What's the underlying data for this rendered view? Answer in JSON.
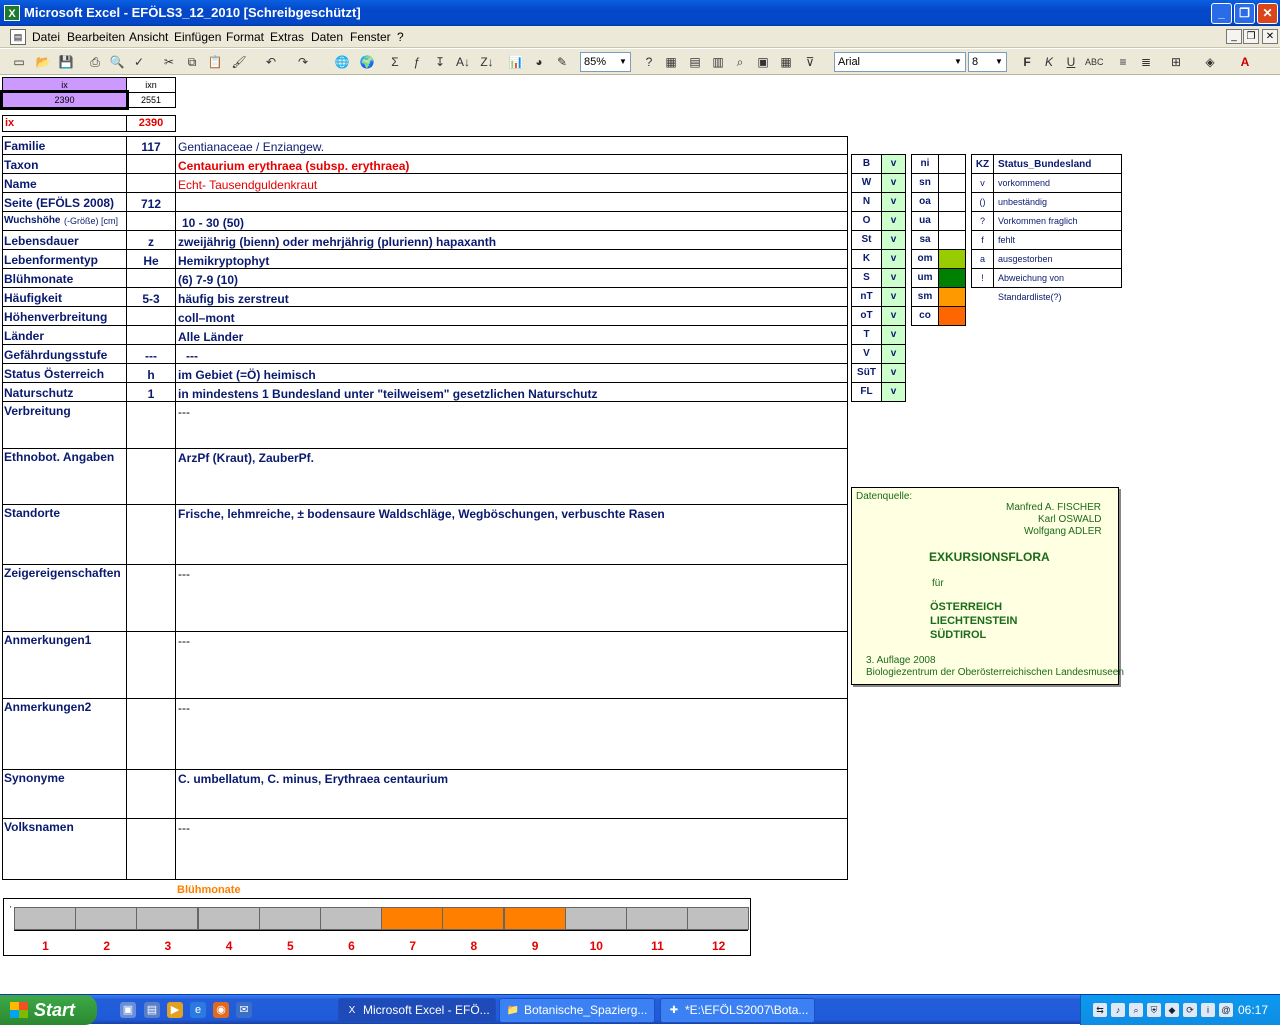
{
  "window": {
    "title": "Microsoft Excel - EFÖLS3_12_2010  [Schreibgeschützt]",
    "btn_min": "_",
    "btn_max": "❐",
    "btn_close": "✕"
  },
  "menu": {
    "items": [
      "Datei",
      "Bearbeiten",
      "Ansicht",
      "Einfügen",
      "Format",
      "Extras",
      "Daten",
      "Fenster",
      "?"
    ]
  },
  "toolbar": {
    "zoom": "85%",
    "font": "Arial",
    "size": "8"
  },
  "header": {
    "ix_label": "ix",
    "ixn_label": "ixn",
    "ix_value": "2390",
    "ixn_value": "2551",
    "ix2_label": "ix",
    "ix2_value": "2390"
  },
  "fields": [
    {
      "label": "Familie",
      "code": "117",
      "value": "Gentianaceae / Enziangew."
    },
    {
      "label": "Taxon",
      "code": "",
      "value": "Centaurium erythraea (subsp. erythraea)"
    },
    {
      "label": "Name",
      "code": "",
      "value": "Echt- Tausendguldenkraut"
    },
    {
      "label": "Seite (EFÖLS 2008)",
      "code": "712",
      "value": ""
    },
    {
      "label": "Wuchshöhe",
      "label_small": " (-Größe) [cm]",
      "code": "",
      "value": "10 - 30 (50)"
    },
    {
      "label": "Lebensdauer",
      "code": "z",
      "value": "zweijährig (bienn) oder mehrjährig (plurienn) hapaxanth"
    },
    {
      "label": "Lebenformentyp",
      "code": "He",
      "value": "Hemikryptophyt"
    },
    {
      "label": "Blühmonate",
      "code": "",
      "value": "(6) 7-9 (10)"
    },
    {
      "label": "Häufigkeit",
      "code": "5-3",
      "value": "häufig bis zerstreut"
    },
    {
      "label": "Höhenverbreitung",
      "code": "",
      "value": "coll–mont"
    },
    {
      "label": "Länder",
      "code": "",
      "value": "Alle Länder"
    },
    {
      "label": "Gefährdungsstufe",
      "code": "---",
      "value": "---"
    },
    {
      "label": "Status Österreich",
      "code": "h",
      "value": "im Gebiet (=Ö) heimisch"
    },
    {
      "label": "Naturschutz",
      "code": "1",
      "value": "in mindestens 1 Bundesland unter \"teilweisem\" gesetzlichen Naturschutz"
    }
  ],
  "bigfields": [
    {
      "label": "Verbreitung",
      "value": "---"
    },
    {
      "label": "Ethnobot. Angaben",
      "value": "ArzPf (Kraut), ZauberPf."
    },
    {
      "label": "Standorte",
      "value": "Frische, lehmreiche, ± bodensaure Waldschläge, Wegböschungen, verbuschte Rasen"
    },
    {
      "label": "Zeigereigenschaften",
      "value": "---"
    },
    {
      "label": "Anmerkungen1",
      "value": "---"
    },
    {
      "label": "Anmerkungen2",
      "value": "---"
    },
    {
      "label": "Synonyme",
      "value": "C. umbellatum, C. minus, Erythraea centaurium"
    },
    {
      "label": "Volksnamen",
      "value": "---"
    }
  ],
  "states": [
    {
      "code": "B",
      "v": "v"
    },
    {
      "code": "W",
      "v": "v"
    },
    {
      "code": "N",
      "v": "v"
    },
    {
      "code": "O",
      "v": "v"
    },
    {
      "code": "St",
      "v": "v"
    },
    {
      "code": "K",
      "v": "v"
    },
    {
      "code": "S",
      "v": "v"
    },
    {
      "code": "nT",
      "v": "v"
    },
    {
      "code": "oT",
      "v": "v"
    },
    {
      "code": "T",
      "v": "v"
    },
    {
      "code": "V",
      "v": "v"
    },
    {
      "code": "SüT",
      "v": "v"
    },
    {
      "code": "FL",
      "v": "v"
    }
  ],
  "zones": [
    {
      "code": "ni",
      "color": "#ffffff"
    },
    {
      "code": "sn",
      "color": "#ffffff"
    },
    {
      "code": "oa",
      "color": "#ffffff"
    },
    {
      "code": "ua",
      "color": "#ffffff"
    },
    {
      "code": "sa",
      "color": "#ffffff"
    },
    {
      "code": "om",
      "color": "#99cc00"
    },
    {
      "code": "um",
      "color": "#008000"
    },
    {
      "code": "sm",
      "color": "#ff9900"
    },
    {
      "code": "co",
      "color": "#ff6600"
    }
  ],
  "legend": {
    "head_kz": "KZ",
    "head_status": "Status_Bundesland",
    "rows": [
      {
        "k": "v",
        "t": "vorkommend"
      },
      {
        "k": "()",
        "t": "unbeständig"
      },
      {
        "k": "?",
        "t": "Vorkommen fraglich"
      },
      {
        "k": "f",
        "t": "fehlt"
      },
      {
        "k": "a",
        "t": "ausgestorben"
      },
      {
        "k": "!",
        "t": "Abweichung von Standardliste(?)"
      }
    ]
  },
  "source": {
    "label": "Datenquelle:",
    "a1": "Manfred A. FISCHER",
    "a2": "Karl OSWALD",
    "a3": "Wolfgang ADLER",
    "title": "EXKURSIONSFLORA",
    "fuer": "für",
    "c1": "ÖSTERREICH",
    "c2": "LIECHTENSTEIN",
    "c3": "SÜDTIROL",
    "edition": "3. Auflage 2008",
    "publisher": "Biologiezentrum der Oberösterreichischen Landesmuseen"
  },
  "bloom": {
    "title": "Blühmonate",
    "months": [
      "1",
      "2",
      "3",
      "4",
      "5",
      "6",
      "7",
      "8",
      "9",
      "10",
      "11",
      "12"
    ],
    "active": [
      false,
      false,
      false,
      false,
      false,
      false,
      true,
      true,
      true,
      false,
      false,
      false
    ],
    "active_color": "#ff7f00",
    "inactive_color": "#c0c0c0"
  },
  "taskbar": {
    "start": "Start",
    "tasks": [
      "Microsoft Excel - EFÖ...",
      "Botanische_Spazierg...",
      "*E:\\EFÖLS2007\\Bota..."
    ],
    "clock": "06:17"
  }
}
